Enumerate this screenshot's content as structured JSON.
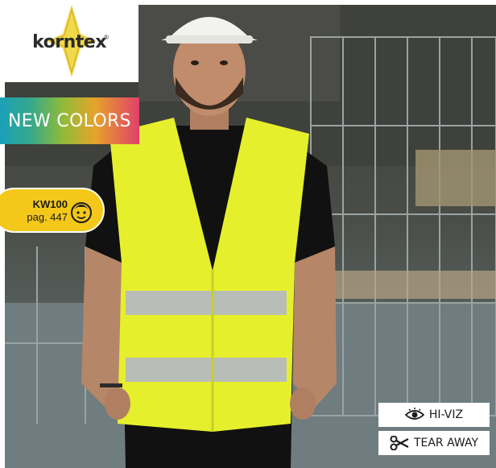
{
  "brand": {
    "name": "korntex",
    "reg_mark": "®"
  },
  "banner": {
    "label": "NEW COLORS"
  },
  "badge": {
    "code": "KW100",
    "page": "pag. 447",
    "icon": "child-face-icon"
  },
  "features": [
    {
      "icon": "eye-icon",
      "label": "HI-VIZ"
    },
    {
      "icon": "scissors-icon",
      "label": "TEAR AWAY"
    }
  ],
  "colors": {
    "vest": "#e6ef2c",
    "badge": "#f4c81a",
    "logo_star": "#f2d84c"
  }
}
